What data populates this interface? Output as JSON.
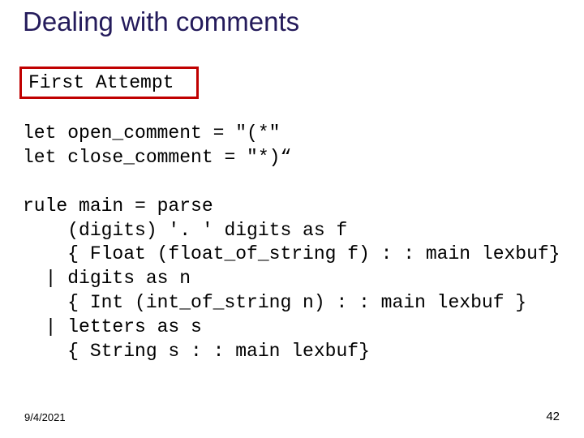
{
  "title": "Dealing with comments",
  "attempt_label": "First Attempt",
  "code": "let open_comment = \"(*\"\nlet close_comment = \"*)“\n\nrule main = parse\n    (digits) '. ' digits as f\n    { Float (float_of_string f) : : main lexbuf}\n  | digits as n\n    { Int (int_of_string n) : : main lexbuf }\n  | letters as s\n    { String s : : main lexbuf}",
  "footer": {
    "date": "9/4/2021",
    "pagenum": "42"
  }
}
